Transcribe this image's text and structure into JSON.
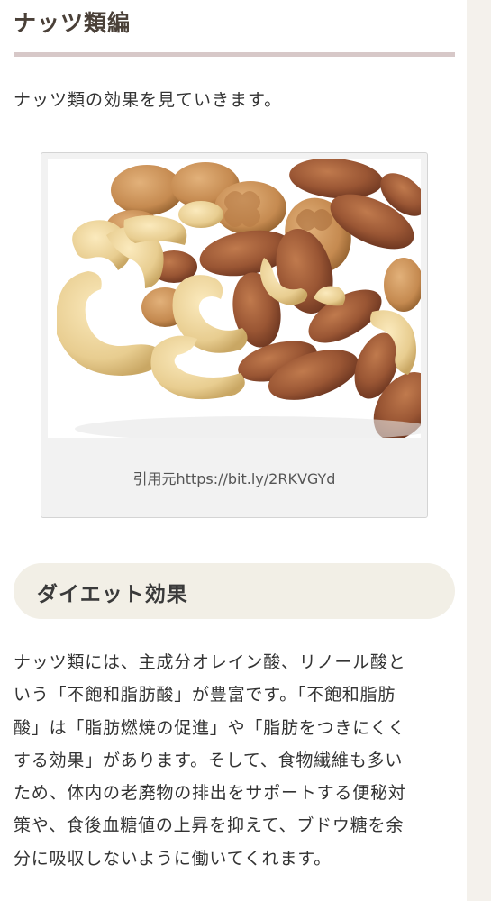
{
  "section_heading": "ナッツ類編",
  "intro": "ナッツ類の効果を見ていきます。",
  "figure": {
    "image_alt": "mixed nuts: almonds, walnuts, cashews",
    "caption": "引用元https://bit.ly/2RKVGYd"
  },
  "subheading": "ダイエット効果",
  "paragraph_lines": [
    "ナッツ類には、主成分オレイン酸、リノール酸と",
    "いう「不飽和脂肪酸」が豊富です。「不飽和脂肪",
    "酸」は「脂肪燃焼の促進」や「脂肪をつきにくく",
    "する効果」があります。そして、食物繊維も多い",
    "ため、体内の老廃物の排出をサポートする便秘対",
    "策や、食後血糖値の上昇を抑えて、ブドウ糖を余",
    "分に吸収しないように働いてくれます。"
  ],
  "colors": {
    "heading_underline": "#d7c8c8",
    "subheading_bg": "#f2efe6",
    "almond": "#9a5634",
    "walnut": "#c98e55",
    "cashew": "#ecd49c"
  }
}
